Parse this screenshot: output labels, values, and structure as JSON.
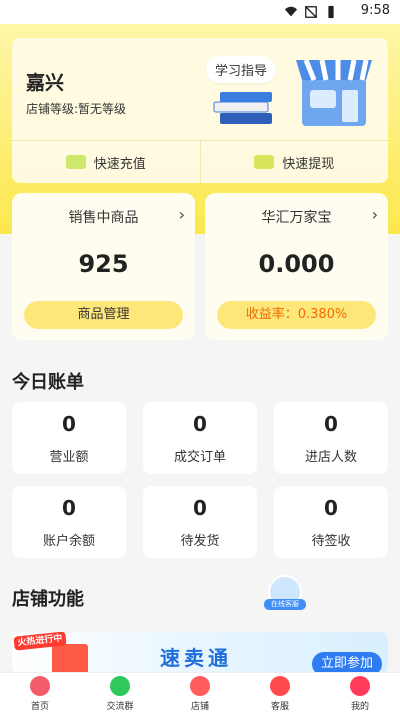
{
  "status_bar": {
    "time": "9:58"
  },
  "store": {
    "name": "嘉兴",
    "level_text": "店铺等级:暂无等级",
    "guide_label": "学习指导",
    "quick_actions": [
      {
        "label": "快速充值",
        "icon": "wallet-icon"
      },
      {
        "label": "快速提现",
        "icon": "cash-icon"
      }
    ]
  },
  "cards": [
    {
      "title": "销售中商品",
      "value": "925",
      "button": "商品管理"
    },
    {
      "title": "华汇万家宝",
      "value": "0.000",
      "button": "收益率：0.380%"
    }
  ],
  "bills": {
    "title": "今日账单",
    "items": [
      {
        "value": "0",
        "label": "营业额"
      },
      {
        "value": "0",
        "label": "成交订单"
      },
      {
        "value": "0",
        "label": "进店人数"
      },
      {
        "value": "0",
        "label": "账户余额"
      },
      {
        "value": "0",
        "label": "待发货"
      },
      {
        "value": "0",
        "label": "待签收"
      }
    ]
  },
  "functions": {
    "title": "店铺功能",
    "service_label": "在线客服",
    "banner": {
      "tag": "火热进行中",
      "title": "速卖通",
      "button": "立即参加"
    }
  },
  "tabs": [
    {
      "label": "首页",
      "icon": "home-icon",
      "color": "#f25c6b"
    },
    {
      "label": "交流群",
      "icon": "wechat-icon",
      "color": "#2fc85a"
    },
    {
      "label": "店铺",
      "icon": "store-icon",
      "color": "#ff5c5c"
    },
    {
      "label": "客服",
      "icon": "service-icon",
      "color": "#ff4b4b"
    },
    {
      "label": "我的",
      "icon": "profile-icon",
      "color": "#ff3b5c"
    }
  ],
  "colors": {
    "accent_yellow": "#fbe84d",
    "primary_blue": "#2f7bf1"
  }
}
